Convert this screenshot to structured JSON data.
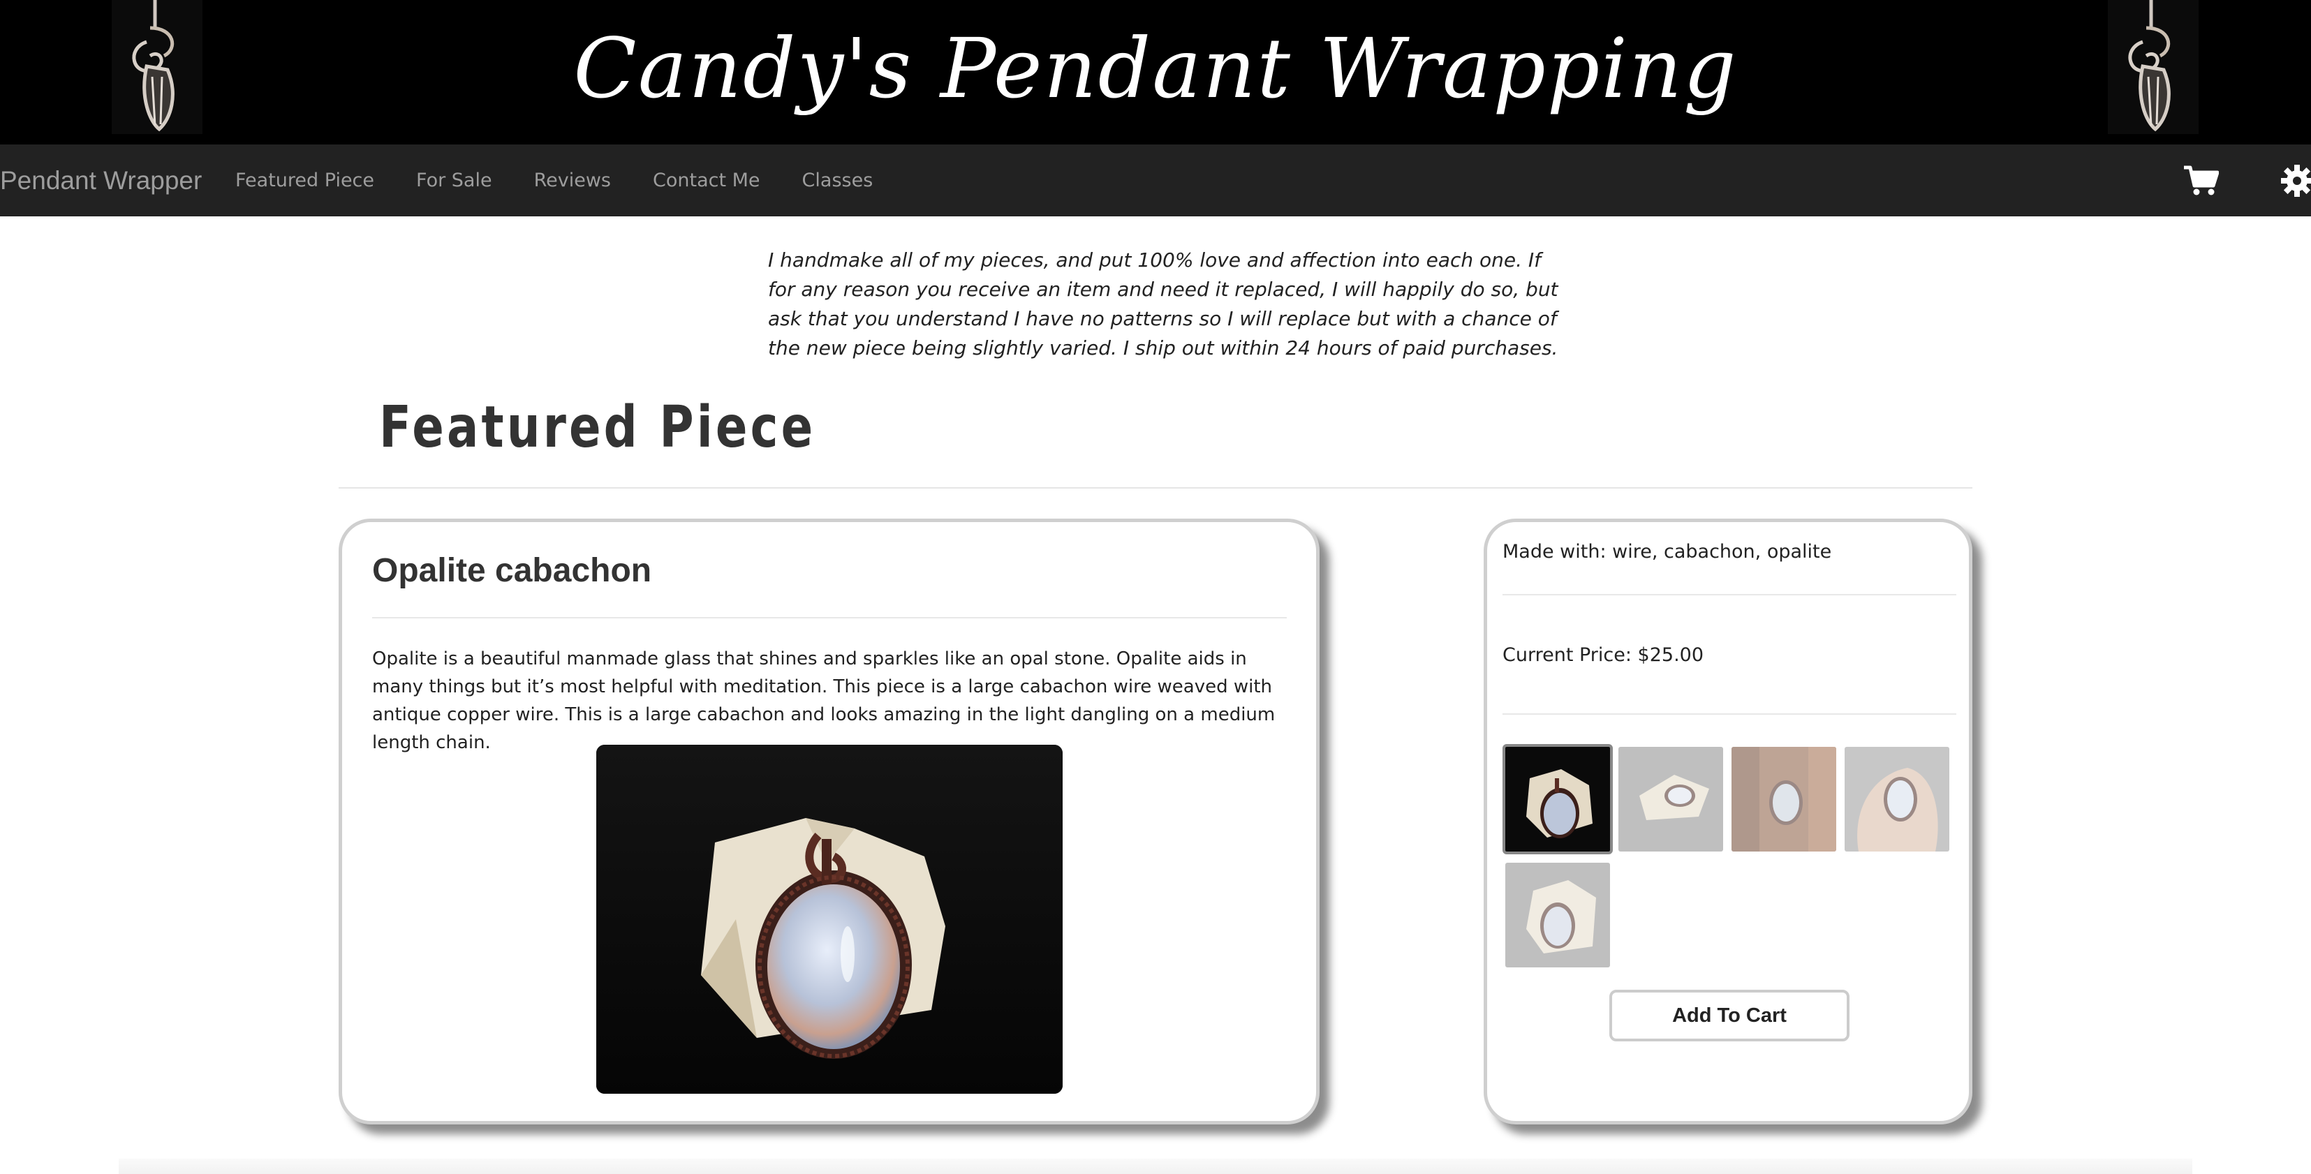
{
  "header": {
    "title": "Candy's Pendant Wrapping"
  },
  "navbar": {
    "brand": "Pendant Wrapper",
    "links": [
      "Featured Piece",
      "For Sale",
      "Reviews",
      "Contact Me",
      "Classes"
    ],
    "icons": [
      "shopping-cart-icon",
      "gear-icon"
    ]
  },
  "intro": {
    "text": "I handmake all of my pieces, and put 100% love and affection into each one. If for any reason you receive an item and need it replaced, I will happily do so, but ask that you understand I have no patterns so I will replace but with a chance of the new piece being slightly varied. I ship out within 24 hours of paid purchases."
  },
  "featured": {
    "section_title": "Featured Piece",
    "piece_title": "Opalite cabachon",
    "description": "Opalite is a beautiful manmade glass that shines and sparkles like an opal stone. Opalite aids in many things but it’s most helpful with meditation. This piece is a large cabachon wire weaved with antique copper wire. This is a large cabachon and looks amazing in the light dangling on a medium length chain.",
    "made_with": "Made with: wire, cabachon, opalite",
    "price": "Current Price: $25.00",
    "add_to_cart_label": "Add To Cart",
    "thumbnail_count": 5,
    "selected_thumbnail": 1
  },
  "colors": {
    "banner_bg": "#000000",
    "navbar_bg": "#222222",
    "nav_text": "#9d9d9d",
    "card_border": "#cfcfcf"
  }
}
